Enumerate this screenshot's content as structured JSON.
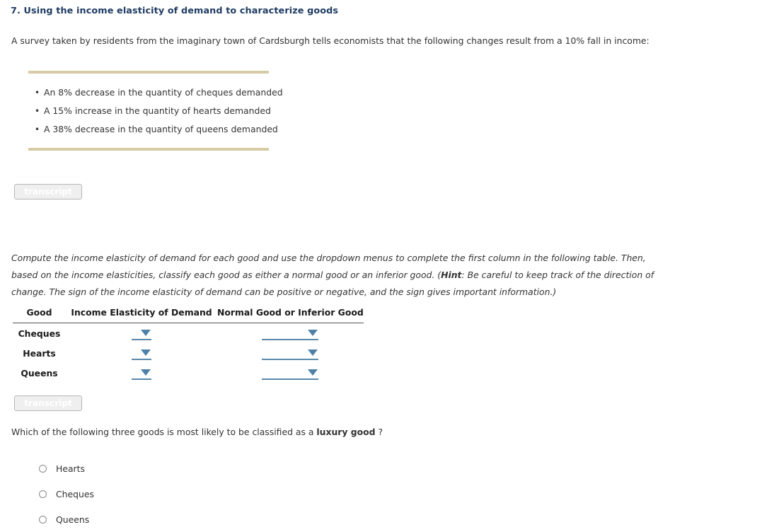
{
  "page_title": "7. Using the income elasticity of demand to characterize goods",
  "intro": "A survey taken by residents from the imaginary town of Cardsburgh tells economists that the following changes result from a 10% fall in income:",
  "bullets": [
    "An 8% decrease in the quantity of cheques demanded",
    "A 15% increase in the quantity of hearts demanded",
    "A 38% decrease in the quantity of queens demanded"
  ],
  "bullet_marker": "•",
  "transcript_top_label": "transcript",
  "transcript_bottom_label": "transcript",
  "instructions": {
    "part1": "Compute the income elasticity of demand for each good and use the dropdown menus to complete the first column in the following table. Then, based on the income elasticities, classify each good as either a normal good or an inferior good. (",
    "hint_label": "Hint",
    "part2": ": Be careful to keep track of the direction of change. The sign of the income elasticity of demand can be positive or negative, and the sign gives important information.)"
  },
  "table": {
    "headers": {
      "good": "Good",
      "elasticity": "Income Elasticity of Demand",
      "classification": "Normal Good or Inferior Good"
    },
    "rows": [
      {
        "good": "Cheques",
        "elasticity_value": "",
        "classification_value": ""
      },
      {
        "good": "Hearts",
        "elasticity_value": "",
        "classification_value": ""
      },
      {
        "good": "Queens",
        "elasticity_value": "",
        "classification_value": ""
      }
    ]
  },
  "question": {
    "part1": "Which of the following three goods is most likely to be classified as a ",
    "emphasis": "luxury good",
    "part2": " ?"
  },
  "options": [
    {
      "label": "Hearts",
      "selected": false
    },
    {
      "label": "Cheques",
      "selected": false
    },
    {
      "label": "Queens",
      "selected": false
    }
  ],
  "colors": {
    "title": "#1f3b63",
    "rule": "#d5cca6",
    "dropdown_accent": "#4f81a8",
    "text": "#333333"
  }
}
